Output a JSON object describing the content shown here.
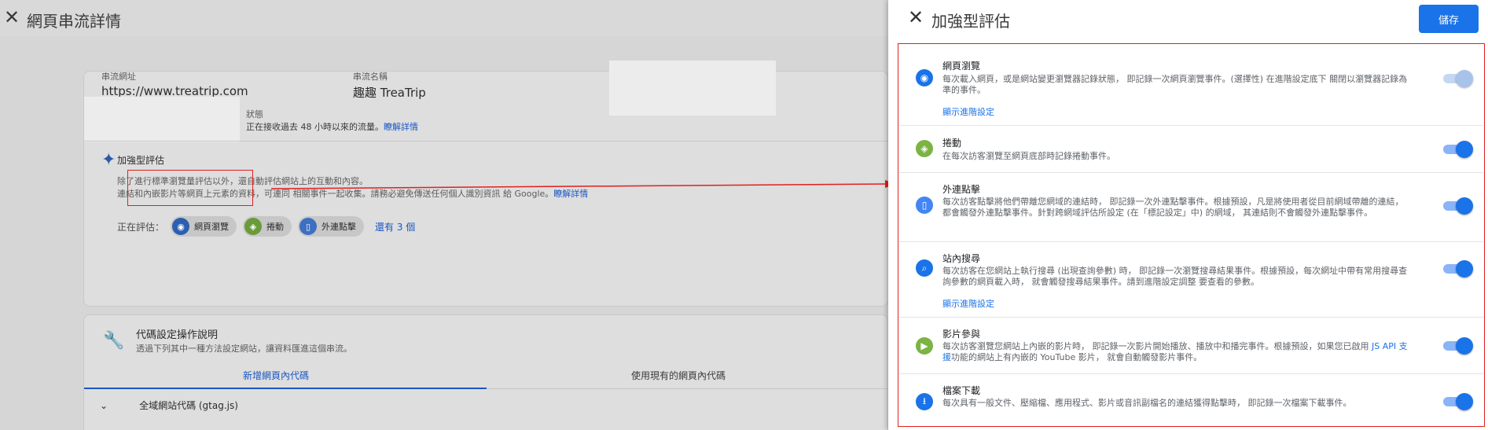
{
  "left": {
    "title": "網頁串流詳情",
    "stream_url_label": "串流網址",
    "stream_url": "https://www.treatrip.com",
    "stream_name_label": "串流名稱",
    "stream_name": "趣趣 TreaTrip",
    "status_label": "狀態",
    "status_text": "正在接收過去 48 小時以來的流量。",
    "status_link": "瞭解詳情",
    "enh_label": "加強型評估",
    "enh_desc_1": "除了進行標準瀏覽量評估以外，還自動評估網站上的互動和內容。",
    "enh_desc_2": "連結和內嵌影片等網頁上元素的資料，可連同 相關事件一起收集。請務必避免傳送任何個人識別資訊 給 Google。",
    "enh_desc_link": "瞭解詳情",
    "evaluating_label": "正在評估：",
    "chips": [
      "網頁瀏覽",
      "捲動",
      "外連點擊"
    ],
    "more_link": "還有 3 個",
    "tag_title": "代碼設定操作說明",
    "tag_sub": "透過下列其中一種方法設定網站，讓資料匯進這個串流。",
    "tab_new": "新增網頁內代碼",
    "tab_existing": "使用現有的網頁內代碼",
    "gtag_label": "全域網站代碼 (gtag.js)"
  },
  "drawer": {
    "title": "加強型評估",
    "save_label": "儲存",
    "items": [
      {
        "title": "網頁瀏覽",
        "desc": "每次載入網頁，或是網站變更瀏覽器記錄狀態， 即記錄一次網頁瀏覽事件。(選擇性) 在進階設定底下 關閉以瀏覽器記錄為準的事件。",
        "link": "顯示進階設定",
        "icon": "eye-icon",
        "color": "#1a73e8",
        "enabled": true,
        "locked": true
      },
      {
        "title": "捲動",
        "desc": "在每次訪客瀏覽至網頁底部時記錄捲動事件。",
        "link": "",
        "icon": "scroll-icon",
        "color": "#7cb342",
        "enabled": true,
        "locked": false
      },
      {
        "title": "外連點擊",
        "desc": "每次訪客點擊將他們帶離您網域的連結時， 即記錄一次外連點擊事件。根據預設，凡是將使用者從目前網域帶離的連結， 都會觸發外連點擊事件。針對跨網域評估所設定 (在「標記設定」中) 的網域， 其連結則不會觸發外連點擊事件。",
        "link": "",
        "icon": "mouse-icon",
        "color": "#4285f4",
        "enabled": true,
        "locked": false
      },
      {
        "title": "站內搜尋",
        "desc": "每次訪客在您網站上執行搜尋 (出現查詢參數) 時， 即記錄一次瀏覽搜尋結果事件。根據預設，每次網址中帶有常用搜尋查詢參數的網頁載入時， 就會觸發搜尋結果事件。請到進階設定調整 要查看的參數。",
        "link": "顯示進階設定",
        "icon": "search-icon",
        "color": "#1a73e8",
        "enabled": true,
        "locked": false
      },
      {
        "title": "影片參與",
        "desc_pre": "每次訪客瀏覽您網站上內嵌的影片時， 即記錄一次影片開始播放、播放中和播完事件。根據預設，如果您已啟用 ",
        "desc_link": "JS API 支援",
        "desc_post": "功能的網站上有內嵌的 YouTube 影片， 就會自動觸發影片事件。",
        "icon": "play-icon",
        "color": "#7cb342",
        "enabled": true,
        "locked": false
      },
      {
        "title": "檔案下載",
        "desc": "每次具有一般文件、壓縮檔、應用程式、影片或音訊副檔名的連結獲得點擊時， 即記錄一次檔案下載事件。",
        "link": "",
        "icon": "download-icon",
        "color": "#1a73e8",
        "enabled": true,
        "locked": false
      }
    ]
  }
}
